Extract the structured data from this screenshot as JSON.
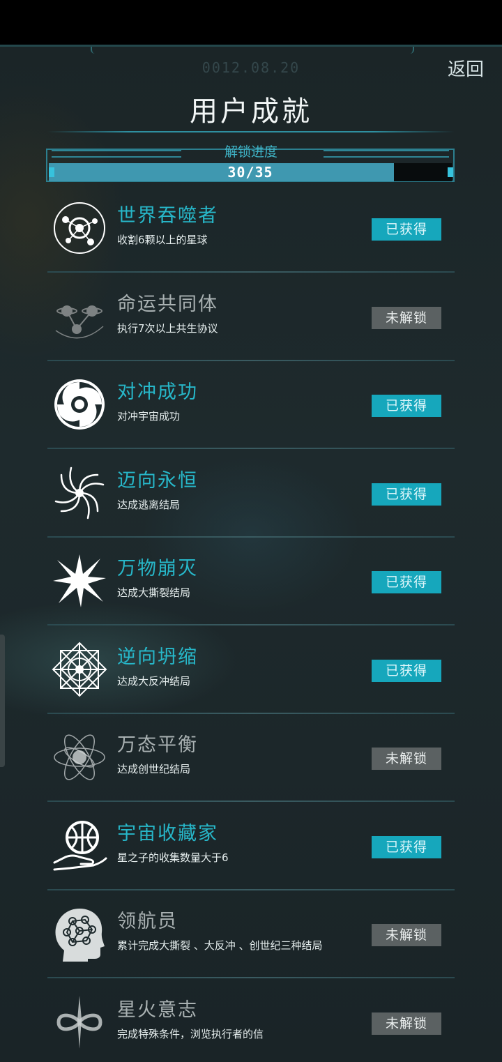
{
  "header": {
    "date": "0012.08.20",
    "back_label": "返回",
    "title": "用户成就"
  },
  "progress": {
    "label": "解锁进度",
    "text": "30/35",
    "unlocked": 30,
    "total": 35,
    "fill_ratio": 0.857
  },
  "status_labels": {
    "earned": "已获得",
    "locked": "未解锁"
  },
  "colors": {
    "accent": "#27b7c9",
    "earned_badge": "#16a7bc",
    "locked_badge": "#5b6162",
    "background": "#1e2a2d"
  },
  "achievements": [
    {
      "name": "世界吞噬者",
      "desc": "收割6颗以上的星球",
      "status": "已获得",
      "icon": "planet-orbit-icon"
    },
    {
      "name": "命运共同体",
      "desc": "执行7次以上共生协议",
      "status": "未解锁",
      "icon": "linked-planets-icon"
    },
    {
      "name": "对冲成功",
      "desc": "对冲宇宙成功",
      "status": "已获得",
      "icon": "vortex-swirl-icon"
    },
    {
      "name": "迈向永恒",
      "desc": "达成逃离结局",
      "status": "已获得",
      "icon": "spiral-galaxy-icon"
    },
    {
      "name": "万物崩灭",
      "desc": "达成大撕裂结局",
      "status": "已获得",
      "icon": "burst-explosion-icon"
    },
    {
      "name": "逆向坍缩",
      "desc": "达成大反冲结局",
      "status": "已获得",
      "icon": "mandala-crystal-icon"
    },
    {
      "name": "万态平衡",
      "desc": "达成创世纪结局",
      "status": "未解锁",
      "icon": "atom-orbits-icon"
    },
    {
      "name": "宇宙收藏家",
      "desc": "星之子的收集数量大于6",
      "status": "已获得",
      "icon": "hand-holding-orb-icon"
    },
    {
      "name": "领航员",
      "desc": "累计完成大撕裂 、大反冲 、创世纪三种结局",
      "status": "未解锁",
      "icon": "brain-head-icon"
    },
    {
      "name": "星火意志",
      "desc": "完成特殊条件，浏览执行者的信",
      "status": "未解锁",
      "icon": "star-infinity-icon"
    }
  ]
}
